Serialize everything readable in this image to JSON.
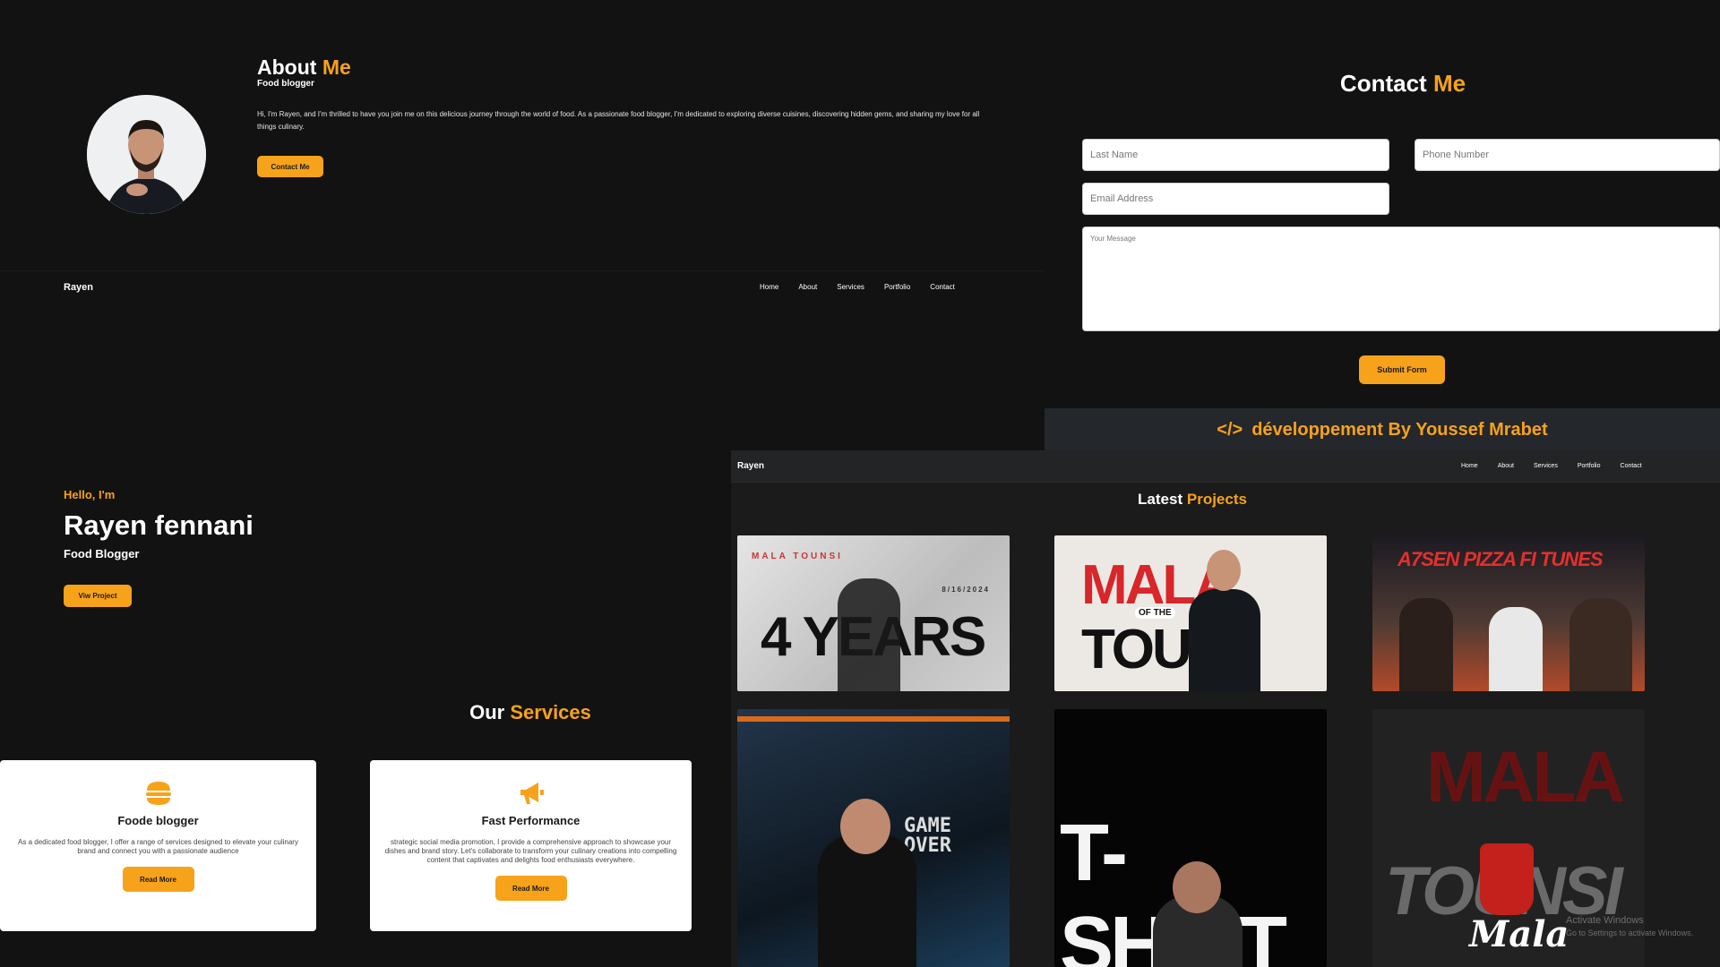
{
  "about": {
    "title_a": "About",
    "title_b": "Me",
    "subtitle": "Food blogger",
    "text": "Hi, I'm Rayen, and I'm thrilled to have you join me on this delicious journey through the world of food. As a passionate food blogger, I'm dedicated to exploring diverse cuisines, discovering hidden gems, and sharing my love for all things culinary.",
    "button": "Contact Me"
  },
  "hero": {
    "brand": "Rayen",
    "nav": [
      "Home",
      "About",
      "Services",
      "Portfolio",
      "Contact"
    ],
    "hello": "Hello, I'm",
    "name": "Rayen fennani",
    "role": "Food Blogger",
    "button": "Viw Project"
  },
  "services": {
    "title_a": "Our",
    "title_b": "Services",
    "cards": [
      {
        "title": "Foode blogger",
        "text": "As a dedicated food blogger, I offer a range of services designed to elevate your culinary brand and connect you with a passionate audience",
        "button": "Read More",
        "icon": "burger-icon"
      },
      {
        "title": "Fast Performance",
        "text": "strategic social media promotion, I provide a comprehensive approach to showcase your dishes and brand story. Let's collaborate to transform your culinary creations into compelling content that captivates and delights food enthusiasts everywhere.",
        "button": "Read More",
        "icon": "megaphone-icon"
      }
    ]
  },
  "contact": {
    "title_a": "Contact",
    "title_b": "Me",
    "last_name_placeholder": "Last Name",
    "phone_placeholder": "Phone Number",
    "email_placeholder": "Email Address",
    "message_placeholder": "Your Message",
    "submit": "Submit Form"
  },
  "footer": {
    "icon": "code-icon",
    "code_glyph": "</>",
    "text": "développement By Youssef Mrabet"
  },
  "projects": {
    "brand": "Rayen",
    "nav": [
      "Home",
      "About",
      "Services",
      "Portfolio",
      "Contact"
    ],
    "title_a": "Latest",
    "title_b": "Projects",
    "thumbs": [
      {
        "label": "MALA TOUNSI 4 YEARS",
        "big": "4 YEARS",
        "small": "MALA TOUNSI",
        "date": "8/16/2024"
      },
      {
        "label": "MALA OF THE TOUN",
        "big": "MALA",
        "mid": "OF THE",
        "big2": "TOUN"
      },
      {
        "label": "A7SEN PIZZA FI TUNES",
        "big": "A7SEN PIZZA FI TUNES"
      },
      {
        "label": "GAME OVER",
        "big": "GAME OVER"
      },
      {
        "label": "T-SHIRT",
        "big": "T-SHIRT"
      },
      {
        "label": "MALA TOUNSI",
        "big": "MALA",
        "big2": "TOUNSI",
        "script": "Mala"
      }
    ]
  },
  "os_watermark": {
    "line1": "Activate Windows",
    "line2": "Go to Settings to activate Windows."
  },
  "colors": {
    "accent": "#f7a21b",
    "background": "#121212",
    "footer_bg": "#24272b"
  }
}
